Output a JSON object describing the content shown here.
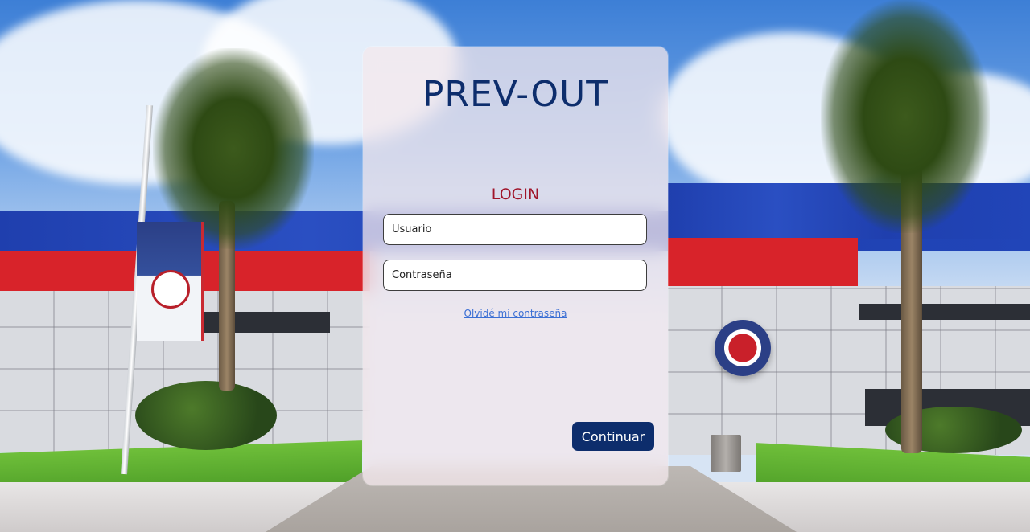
{
  "app": {
    "title": "PREV-OUT"
  },
  "login": {
    "heading": "LOGIN",
    "username_placeholder": "Usuario",
    "password_placeholder": "Contraseña",
    "forgot_password": "Olvidé mi contraseña",
    "continue_label": "Continuar"
  },
  "colors": {
    "brand_navy": "#0d2d6c",
    "login_red": "#a0142a",
    "link_blue": "#3b6fd4"
  }
}
